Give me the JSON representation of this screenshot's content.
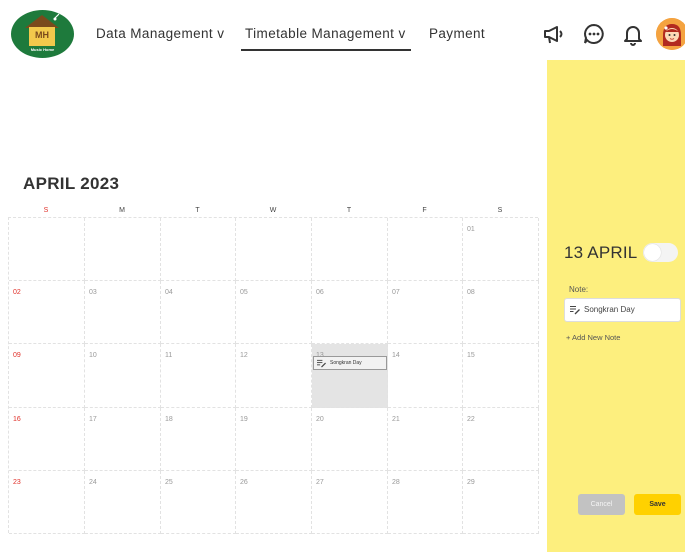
{
  "header": {
    "logo_text": "MH",
    "logo_subtext": "Music Home",
    "nav": [
      {
        "label": "Data Management v"
      },
      {
        "label": "Timetable Management v"
      },
      {
        "label": "Payment"
      }
    ],
    "icons": [
      "megaphone-icon",
      "chat-icon",
      "bell-icon",
      "avatar"
    ]
  },
  "calendar": {
    "title": "APRIL 2023",
    "weekdays": [
      "S",
      "M",
      "T",
      "W",
      "T",
      "F",
      "S"
    ],
    "weeks": [
      [
        "",
        "",
        "",
        "",
        "",
        "",
        "01"
      ],
      [
        "02",
        "03",
        "04",
        "05",
        "06",
        "07",
        "08"
      ],
      [
        "09",
        "10",
        "11",
        "12",
        "13",
        "14",
        "15"
      ],
      [
        "16",
        "17",
        "18",
        "19",
        "20",
        "21",
        "22"
      ],
      [
        "23",
        "24",
        "25",
        "26",
        "27",
        "28",
        "29"
      ]
    ],
    "selected_day": "13",
    "events": [
      {
        "day": "13",
        "label": "Songkran Day"
      }
    ]
  },
  "panel": {
    "date": "13 APRIL",
    "toggle_on": false,
    "note_label": "Note:",
    "note_value": "Songkran Day",
    "add_note": "+ Add New Note",
    "cancel": "Cancel",
    "save": "Save"
  },
  "colors": {
    "panel_bg": "#fdef7e",
    "save_bg": "#ffd100",
    "cancel_bg": "#c2c2c2",
    "sunday_red": "#e0312a",
    "logo_green": "#1e7a3c"
  }
}
